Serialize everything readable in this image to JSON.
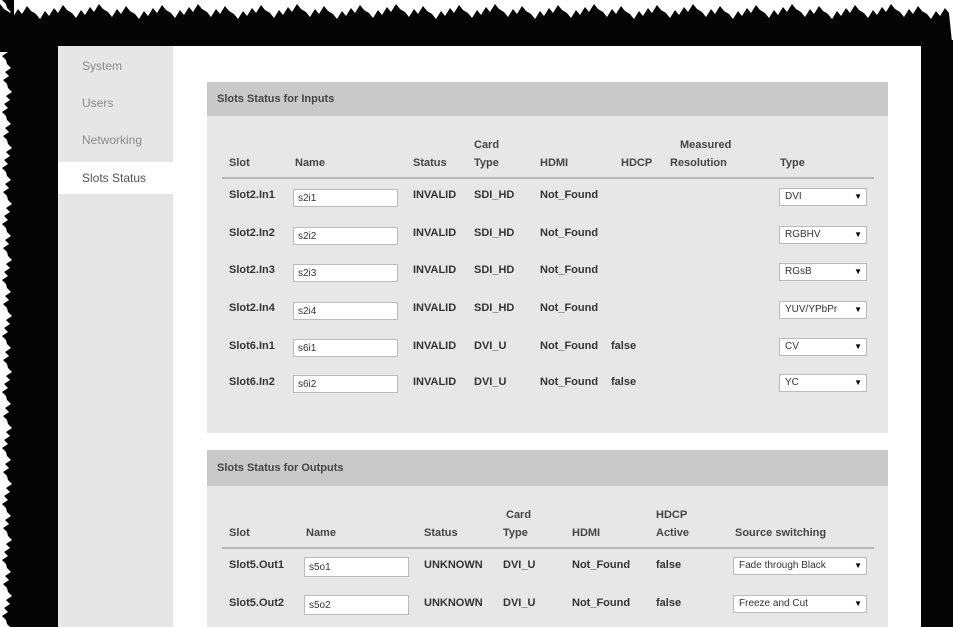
{
  "sidebar": {
    "items": [
      {
        "label": "System"
      },
      {
        "label": "Users"
      },
      {
        "label": "Networking"
      },
      {
        "label": "Slots Status"
      }
    ]
  },
  "inputs": {
    "title": "Slots Status for Inputs",
    "headers": {
      "slot": "Slot",
      "name": "Name",
      "status": "Status",
      "card_type_1": "Card",
      "card_type_2": "Type",
      "hdmi": "HDMI",
      "hdcp": "HDCP",
      "measured_1": "Measured",
      "measured_2": "Resolution",
      "type": "Type"
    },
    "rows": [
      {
        "slot": "Slot2.In1",
        "name": "s2i1",
        "status": "INVALID",
        "card_type": "SDI_HD",
        "hdmi": "Not_Found",
        "hdcp": "",
        "resolution": "",
        "type": "DVI"
      },
      {
        "slot": "Slot2.In2",
        "name": "s2i2",
        "status": "INVALID",
        "card_type": "SDI_HD",
        "hdmi": "Not_Found",
        "hdcp": "",
        "resolution": "",
        "type": "RGBHV"
      },
      {
        "slot": "Slot2.In3",
        "name": "s2i3",
        "status": "INVALID",
        "card_type": "SDI_HD",
        "hdmi": "Not_Found",
        "hdcp": "",
        "resolution": "",
        "type": "RGsB"
      },
      {
        "slot": "Slot2.In4",
        "name": "s2i4",
        "status": "INVALID",
        "card_type": "SDI_HD",
        "hdmi": "Not_Found",
        "hdcp": "",
        "resolution": "",
        "type": "YUV/YPbPr"
      },
      {
        "slot": "Slot6.In1",
        "name": "s6i1",
        "status": "INVALID",
        "card_type": "DVI_U",
        "hdmi": "Not_Found",
        "hdcp": "false",
        "resolution": "",
        "type": "CV"
      },
      {
        "slot": "Slot6.In2",
        "name": "s6i2",
        "status": "INVALID",
        "card_type": "DVI_U",
        "hdmi": "Not_Found",
        "hdcp": "false",
        "resolution": "",
        "type": "YC"
      }
    ]
  },
  "outputs": {
    "title": "Slots Status for Outputs",
    "headers": {
      "slot": "Slot",
      "name": "Name",
      "status": "Status",
      "card_type_1": "Card",
      "card_type_2": "Type",
      "hdmi": "HDMI",
      "hdcp_1": "HDCP",
      "hdcp_2": "Active",
      "source": "Source switching"
    },
    "rows": [
      {
        "slot": "Slot5.Out1",
        "name": "s5o1",
        "status": "UNKNOWN",
        "card_type": "DVI_U",
        "hdmi": "Not_Found",
        "hdcp": "false",
        "source": "Fade through Black"
      },
      {
        "slot": "Slot5.Out2",
        "name": "s5o2",
        "status": "UNKNOWN",
        "card_type": "DVI_U",
        "hdmi": "Not_Found",
        "hdcp": "false",
        "source": "Freeze and Cut"
      }
    ]
  },
  "icons": {
    "dropdown": "caret-down-icon"
  },
  "colors": {
    "frame": "#050505",
    "sidebar": "#e6e6e6",
    "panel": "#e7e7e7",
    "panel_header": "#c9c9c9"
  }
}
